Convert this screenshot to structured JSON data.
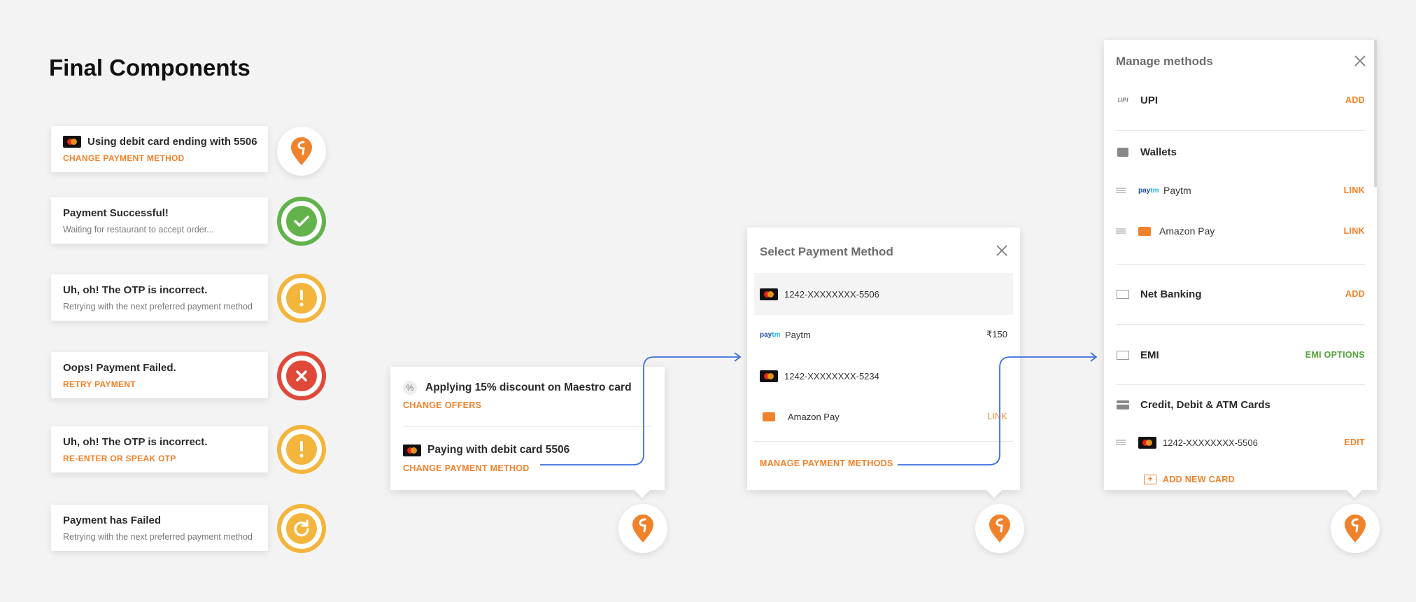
{
  "page_title": "Final Components",
  "cards": [
    {
      "title": "Using debit card ending with 5506",
      "action": "CHANGE PAYMENT METHOD",
      "status": "logo",
      "has_card": true
    },
    {
      "title": "Payment Successful!",
      "subtitle": "Waiting for restaurant to accept order...",
      "status": "success"
    },
    {
      "title": "Uh, oh! The OTP is incorrect.",
      "subtitle": "Retrying with the next preferred payment method",
      "status": "warning"
    },
    {
      "title": "Oops! Payment Failed.",
      "action": "RETRY PAYMENT",
      "status": "error"
    },
    {
      "title": "Uh, oh! The OTP is incorrect.",
      "action": "RE-ENTER OR SPEAK OTP",
      "status": "warning"
    },
    {
      "title": "Payment has Failed",
      "subtitle": "Retrying with the next preferred payment method",
      "status": "retry"
    }
  ],
  "offer_panel": {
    "offer_text": "Applying 15% discount on Maestro card",
    "offer_action": "CHANGE OFFERS",
    "pay_text": "Paying with debit card 5506",
    "pay_action": "CHANGE PAYMENT METHOD"
  },
  "select_panel": {
    "title": "Select Payment Method",
    "rows": [
      {
        "label": "1242-XXXXXXXX-5506",
        "icon": "mastercard-icon",
        "right": ""
      },
      {
        "label": "Paytm",
        "icon": "paytm-icon",
        "right": "₹150"
      },
      {
        "label": "1242-XXXXXXXX-5234",
        "icon": "mastercard-icon",
        "right": ""
      },
      {
        "label": "Amazon Pay",
        "icon": "amazon-pay-icon",
        "right": "LINK"
      }
    ],
    "manage_link": "MANAGE PAYMENT METHODS"
  },
  "manage_panel": {
    "title": "Manage methods",
    "upi": {
      "label": "UPI",
      "action": "ADD",
      "icon_text": "UPI"
    },
    "wallets_label": "Wallets",
    "wallets": [
      {
        "label": "Paytm",
        "action": "LINK"
      },
      {
        "label": "Amazon Pay",
        "action": "LINK"
      }
    ],
    "net_banking": {
      "label": "Net Banking",
      "action": "ADD"
    },
    "emi": {
      "label": "EMI",
      "action": "EMI OPTIONS"
    },
    "cards_label": "Credit, Debit & ATM Cards",
    "saved_card": {
      "label": "1242-XXXXXXXX-5506",
      "action": "EDIT"
    },
    "add_card": "ADD NEW CARD"
  },
  "paytm_logo": {
    "a": "pay",
    "b": "tm"
  },
  "colors": {
    "accent": "#f0822b",
    "success": "#62b34b",
    "warning": "#f3b53c",
    "error": "#e0493a",
    "connector": "#3d6fe0"
  }
}
